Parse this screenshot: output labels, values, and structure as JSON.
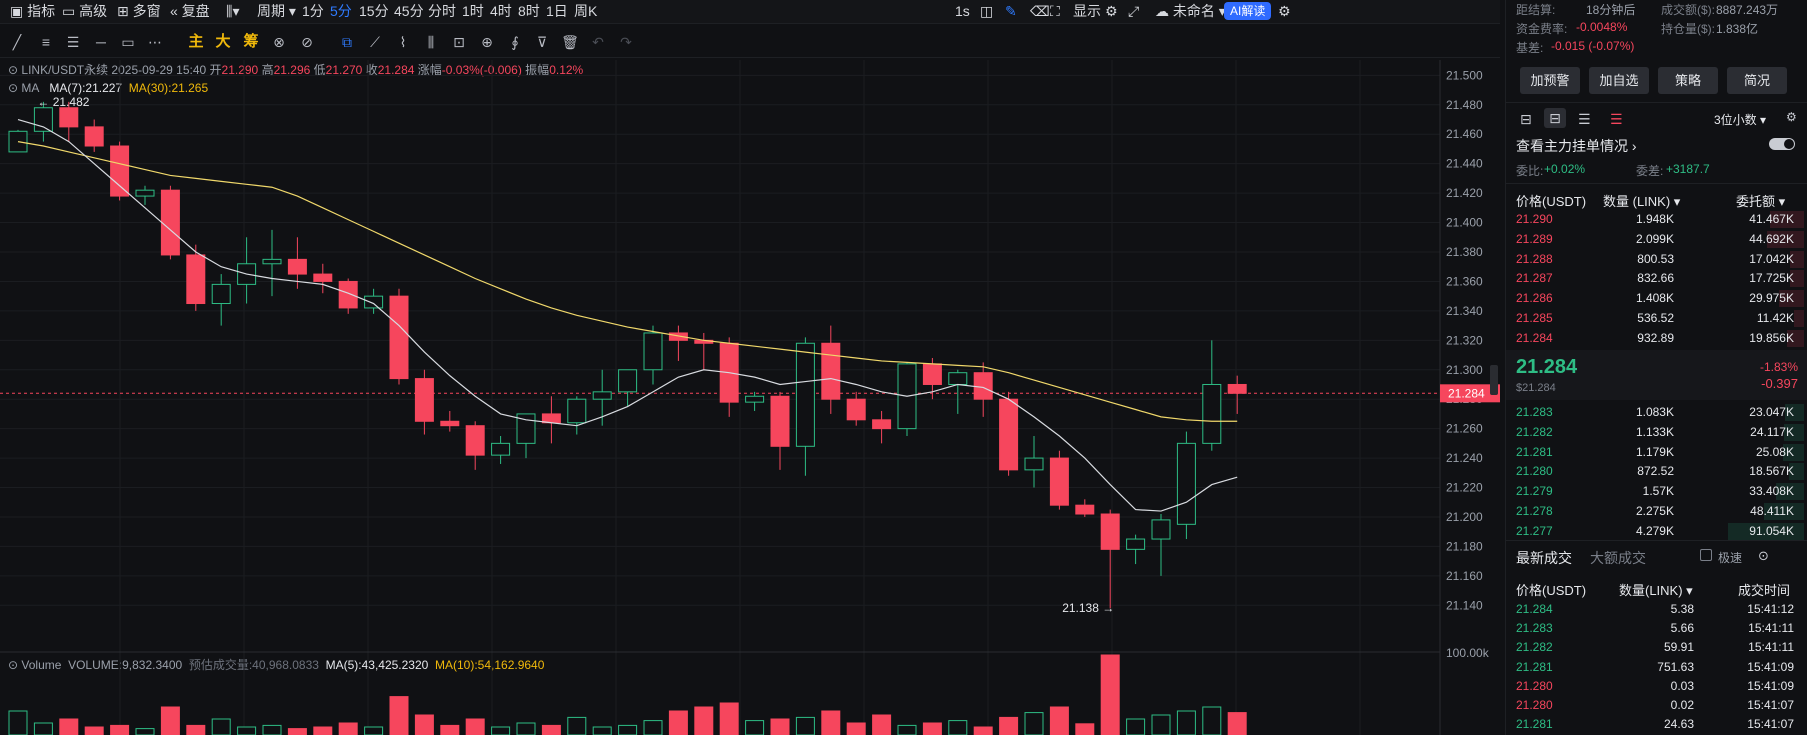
{
  "toolbar": {
    "items": [
      "指标",
      "高级",
      "多窗",
      "复盘",
      "",
      "周期",
      "1分",
      "5分",
      "15分",
      "45分",
      "分时",
      "1时",
      "4时",
      "8时",
      "1日",
      "周K"
    ],
    "active": "5分",
    "right": [
      "1s",
      "显示",
      "未命名",
      "AI解读"
    ]
  },
  "drawbar": {
    "cn_tools": [
      "主",
      "大",
      "筹"
    ]
  },
  "info": {
    "symbol": "LINK/USDT永续",
    "datetime": "2025-09-29 15:40",
    "open_l": "开",
    "open": "21.290",
    "high_l": "高",
    "high": "21.296",
    "low_l": "低",
    "low": "21.270",
    "close_l": "收",
    "close": "21.284",
    "chg_l": "涨幅",
    "chg": "-0.03%(-0.006)",
    "amp_l": "振幅",
    "amp": "0.12%",
    "ma_title": "MA",
    "ma7": "MA(7):21.227",
    "ma30": "MA(30):21.265",
    "vol_title": "Volume",
    "vol": "VOLUME:9,832.3400",
    "vol_est": "预估成交量:40,968.0833",
    "vma5": "MA(5):43,425.2320",
    "vma10": "MA(10):54,162.9640",
    "hi_mark": "21.482",
    "lo_mark": "21.138",
    "cur_price": "21.284",
    "vol_axis": "100.00k"
  },
  "chart_data": {
    "type": "candlestick",
    "y_ticks": [
      "21.500",
      "21.480",
      "21.460",
      "21.440",
      "21.420",
      "21.400",
      "21.380",
      "21.360",
      "21.340",
      "21.320",
      "21.300",
      "21.280",
      "21.260",
      "21.240",
      "21.220",
      "21.200",
      "21.180",
      "21.160",
      "21.140"
    ],
    "ylim": [
      21.13,
      21.505
    ],
    "candles": [
      [
        21.448,
        21.463,
        21.448,
        21.462
      ],
      [
        21.462,
        21.482,
        21.455,
        21.478
      ],
      [
        21.478,
        21.482,
        21.455,
        21.465
      ],
      [
        21.465,
        21.47,
        21.448,
        21.452
      ],
      [
        21.452,
        21.455,
        21.415,
        21.418
      ],
      [
        21.418,
        21.425,
        21.412,
        21.422
      ],
      [
        21.422,
        21.425,
        21.375,
        21.378
      ],
      [
        21.378,
        21.385,
        21.34,
        21.345
      ],
      [
        21.345,
        21.365,
        21.33,
        21.358
      ],
      [
        21.358,
        21.39,
        21.345,
        21.372
      ],
      [
        21.372,
        21.395,
        21.35,
        21.375
      ],
      [
        21.375,
        21.39,
        21.355,
        21.365
      ],
      [
        21.365,
        21.372,
        21.352,
        21.36
      ],
      [
        21.36,
        21.362,
        21.338,
        21.342
      ],
      [
        21.342,
        21.355,
        21.338,
        21.35
      ],
      [
        21.35,
        21.355,
        21.29,
        21.294
      ],
      [
        21.294,
        21.3,
        21.256,
        21.265
      ],
      [
        21.265,
        21.272,
        21.258,
        21.262
      ],
      [
        21.262,
        21.265,
        21.232,
        21.242
      ],
      [
        21.242,
        21.255,
        21.236,
        21.25
      ],
      [
        21.25,
        21.27,
        21.24,
        21.27
      ],
      [
        21.27,
        21.282,
        21.25,
        21.264
      ],
      [
        21.264,
        21.282,
        21.256,
        21.28
      ],
      [
        21.28,
        21.3,
        21.262,
        21.285
      ],
      [
        21.285,
        21.3,
        21.275,
        21.3
      ],
      [
        21.3,
        21.33,
        21.29,
        21.325
      ],
      [
        21.325,
        21.33,
        21.306,
        21.32
      ],
      [
        21.32,
        21.325,
        21.3,
        21.318
      ],
      [
        21.318,
        21.322,
        21.268,
        21.278
      ],
      [
        21.278,
        21.285,
        21.272,
        21.282
      ],
      [
        21.282,
        21.285,
        21.232,
        21.248
      ],
      [
        21.248,
        21.322,
        21.228,
        21.318
      ],
      [
        21.318,
        21.33,
        21.27,
        21.28
      ],
      [
        21.28,
        21.285,
        21.262,
        21.266
      ],
      [
        21.266,
        21.272,
        21.25,
        21.26
      ],
      [
        21.26,
        21.305,
        21.255,
        21.304
      ],
      [
        21.304,
        21.308,
        21.28,
        21.29
      ],
      [
        21.29,
        21.3,
        21.27,
        21.298
      ],
      [
        21.298,
        21.305,
        21.268,
        21.28
      ],
      [
        21.28,
        21.285,
        21.228,
        21.232
      ],
      [
        21.232,
        21.255,
        21.22,
        21.24
      ],
      [
        21.24,
        21.245,
        21.205,
        21.208
      ],
      [
        21.208,
        21.212,
        21.2,
        21.202
      ],
      [
        21.202,
        21.205,
        21.138,
        21.178
      ],
      [
        21.178,
        21.188,
        21.168,
        21.185
      ],
      [
        21.185,
        21.202,
        21.16,
        21.198
      ],
      [
        21.195,
        21.258,
        21.185,
        21.25
      ],
      [
        21.25,
        21.32,
        21.245,
        21.29
      ],
      [
        21.29,
        21.296,
        21.27,
        21.284
      ]
    ],
    "ma7": [
      21.47,
      21.465,
      21.455,
      21.44,
      21.425,
      21.41,
      21.395,
      21.38,
      21.37,
      21.365,
      21.362,
      21.36,
      21.358,
      21.352,
      21.345,
      21.33,
      21.312,
      21.296,
      21.282,
      21.27,
      21.266,
      21.264,
      21.262,
      21.268,
      21.275,
      21.285,
      21.295,
      21.3,
      21.298,
      21.295,
      21.29,
      21.292,
      21.294,
      21.29,
      21.285,
      21.282,
      21.285,
      21.29,
      21.288,
      21.28,
      21.268,
      21.255,
      21.24,
      21.222,
      21.205,
      21.204,
      21.21,
      21.222,
      21.227
    ],
    "ma30": [
      21.455,
      21.452,
      21.448,
      21.444,
      21.44,
      21.436,
      21.432,
      21.43,
      21.428,
      21.426,
      21.424,
      21.418,
      21.41,
      21.402,
      21.394,
      21.386,
      21.378,
      21.37,
      21.362,
      21.355,
      21.348,
      21.342,
      21.337,
      21.333,
      21.329,
      21.326,
      21.323,
      21.32,
      21.318,
      21.316,
      21.314,
      21.312,
      21.31,
      21.308,
      21.306,
      21.305,
      21.304,
      21.303,
      21.302,
      21.298,
      21.293,
      21.288,
      21.283,
      21.278,
      21.273,
      21.268,
      21.266,
      21.265,
      21.265
    ],
    "volumes": [
      30,
      15,
      20,
      10,
      12,
      8,
      35,
      12,
      20,
      10,
      12,
      8,
      10,
      15,
      10,
      48,
      25,
      12,
      20,
      10,
      15,
      12,
      22,
      10,
      12,
      18,
      30,
      35,
      40,
      18,
      20,
      22,
      30,
      15,
      25,
      12,
      15,
      18,
      10,
      22,
      28,
      35,
      14,
      100,
      20,
      25,
      30,
      35,
      28
    ]
  },
  "right": {
    "top": [
      [
        "距结算:",
        "18分钟后"
      ],
      [
        "成交额($):",
        "8887.243万"
      ],
      [
        "资金费率:",
        "-0.0048%"
      ],
      [
        "持仓量($):",
        "1.838亿"
      ],
      [
        "基差:",
        "-0.015 (-0.07%)"
      ]
    ],
    "buttons": [
      "加预警",
      "加自选",
      "策略",
      "简况"
    ],
    "decimals": "3位小数",
    "depth_title": "查看主力挂单情况",
    "ratio_l": "委比:",
    "ratio": "+0.02%",
    "diff_l": "委差:",
    "diff": "+3187.7",
    "cols": [
      "价格(USDT)",
      "数量 (LINK)",
      "委托额"
    ],
    "asks": [
      [
        "21.290",
        "1.948K",
        "41.467K",
        0.45
      ],
      [
        "21.289",
        "2.099K",
        "44.692K",
        0.49
      ],
      [
        "21.288",
        "800.53",
        "17.042K",
        0.19
      ],
      [
        "21.287",
        "832.66",
        "17.725K",
        0.19
      ],
      [
        "21.286",
        "1.408K",
        "29.975K",
        0.33
      ],
      [
        "21.285",
        "536.52",
        "11.42K",
        0.13
      ],
      [
        "21.284",
        "932.89",
        "19.856K",
        0.22
      ]
    ],
    "last": "21.284",
    "last_usd": "$21.284",
    "last_pct": "-1.83%",
    "last_chg": "-0.397",
    "bids": [
      [
        "21.283",
        "1.083K",
        "23.047K",
        0.25
      ],
      [
        "21.282",
        "1.133K",
        "24.117K",
        0.26
      ],
      [
        "21.281",
        "1.179K",
        "25.08K",
        0.27
      ],
      [
        "21.280",
        "872.52",
        "18.567K",
        0.2
      ],
      [
        "21.279",
        "1.57K",
        "33.408K",
        0.37
      ],
      [
        "21.278",
        "2.275K",
        "48.411K",
        0.53
      ],
      [
        "21.277",
        "4.279K",
        "91.054K",
        1.0
      ]
    ],
    "trades_tabs": [
      "最新成交",
      "大额成交"
    ],
    "fast": "极速",
    "tcols": [
      "价格(USDT)",
      "数量(LINK)",
      "成交时间"
    ],
    "trades": [
      [
        "21.284",
        "5.38",
        "15:41:12",
        "g"
      ],
      [
        "21.283",
        "5.66",
        "15:41:11",
        "g"
      ],
      [
        "21.282",
        "59.91",
        "15:41:11",
        "g"
      ],
      [
        "21.281",
        "751.63",
        "15:41:09",
        "g"
      ],
      [
        "21.280",
        "0.03",
        "15:41:09",
        "r"
      ],
      [
        "21.280",
        "0.02",
        "15:41:07",
        "r"
      ],
      [
        "21.281",
        "24.63",
        "15:41:07",
        "g"
      ]
    ]
  }
}
